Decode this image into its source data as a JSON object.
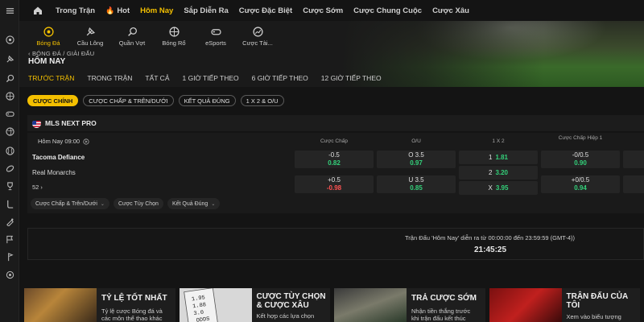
{
  "nav": {
    "items": [
      {
        "label": "Trong Trận",
        "active": false,
        "hot": false
      },
      {
        "label": "Hot",
        "active": false,
        "hot": true
      },
      {
        "label": "Hôm Nay",
        "active": true,
        "hot": false
      },
      {
        "label": "Sắp Diễn Ra",
        "active": false,
        "hot": false
      },
      {
        "label": "Cược Đặc Biệt",
        "active": false,
        "hot": false
      },
      {
        "label": "Cược Sớm",
        "active": false,
        "hot": false
      },
      {
        "label": "Cược Chung Cuộc",
        "active": false,
        "hot": false
      },
      {
        "label": "Cược Xâu",
        "active": false,
        "hot": false
      }
    ]
  },
  "sports": [
    {
      "label": "Bóng Đá",
      "icon": "soccer-ball-icon",
      "active": true
    },
    {
      "label": "Cầu Lông",
      "icon": "badminton-icon",
      "active": false
    },
    {
      "label": "Quần Vợt",
      "icon": "tennis-icon",
      "active": false
    },
    {
      "label": "Bóng Rổ",
      "icon": "basketball-icon",
      "active": false
    },
    {
      "label": "eSports",
      "icon": "gamepad-icon",
      "active": false
    },
    {
      "label": "Cược Tài...",
      "icon": "finance-icon",
      "active": false
    }
  ],
  "breadcrumb": "BÓNG ĐÁ / GIẢI ĐẤU",
  "page_title": "HÔM NAY",
  "tabs": [
    "TRƯỚC TRẬN",
    "TRONG TRẬN",
    "TẤT CẢ",
    "1 GIỜ TIẾP THEO",
    "6 GIỜ TIẾP THEO",
    "12 GIỜ TIẾP THEO"
  ],
  "bet_types": [
    "CƯỢC CHÍNH",
    "CƯỢC CHẤP & TRÊN/DƯỚI",
    "KẾT QUẢ ĐÚNG",
    "1 X 2 & O/U"
  ],
  "league": {
    "name": "MLS NEXT PRO"
  },
  "match": {
    "time": "Hôm Nay 09:00",
    "home": "Tacoma Defiance",
    "away": "Real Monarchs",
    "more": "52",
    "headers": {
      "handicap": "Cược Chấp",
      "ou": "O/U",
      "x12": "1 X 2",
      "handicap_h1": "Cược Chấp Hiệp 1"
    },
    "handicap": [
      {
        "line": "-0.5",
        "odd": "0.82",
        "dir": "up"
      },
      {
        "line": "+0.5",
        "odd": "-0.98",
        "dir": "down"
      }
    ],
    "ou": [
      {
        "line": "O 3.5",
        "odd": "0.97",
        "dir": "up"
      },
      {
        "line": "U 3.5",
        "odd": "0.85",
        "dir": "up"
      }
    ],
    "x12": [
      {
        "line": "1",
        "odd": "1.81",
        "dir": "up"
      },
      {
        "line": "2",
        "odd": "3.20",
        "dir": "up"
      },
      {
        "line": "X",
        "odd": "3.95",
        "dir": "up"
      }
    ],
    "handicap_h1": [
      {
        "line": "-0/0.5",
        "odd": "0.90",
        "dir": "up"
      },
      {
        "line": "+0/0.5",
        "odd": "0.94",
        "dir": "up"
      }
    ],
    "subchips": [
      "Cược Chấp & Trên/Dưới",
      "Cược Tùy Chọn",
      "Kết Quả Đúng"
    ]
  },
  "countdown": {
    "message": "Trận Đấu 'Hôm Nay' diễn ra từ 00:00:00 đến 23:59:59 (GMT-4))",
    "time": "21:45:25"
  },
  "promos": [
    {
      "title1": "TỶ LỆ TỐT NHẤT",
      "title2": "",
      "desc1": "Tỷ lệ cược Bóng đá và",
      "desc2": "các môn thể thao khác"
    },
    {
      "title1": "CƯỢC TÙY CHỌN",
      "title2": "& CƯỢC XÂU",
      "desc1": "Kết hợp các lựa chọn",
      "desc2": ""
    },
    {
      "title1": "TRẢ CƯỢC SỚM",
      "title2": "",
      "desc1": "Nhận tiền thắng trước",
      "desc2": "khi trận đấu kết thúc"
    },
    {
      "title1": "TRẬN ĐẤU CỦA",
      "title2": "TÔI",
      "desc1": "Xem vào biểu tượng",
      "desc2": ""
    }
  ],
  "colors": {
    "accent": "#f4c000",
    "up": "#33d17a",
    "down": "#ff5252"
  }
}
